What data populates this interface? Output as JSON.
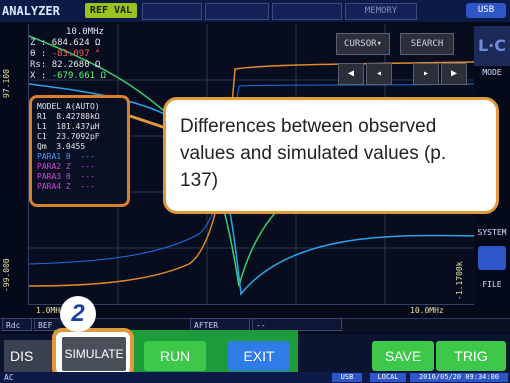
{
  "header": {
    "analyzer_label": "ANALYZER",
    "ref_val_label": "REF VAL",
    "memory_label": "MEMORY",
    "usb_label": "USB"
  },
  "readout": {
    "frequency": "10.0MHz",
    "lines": [
      {
        "label": "Z :",
        "value": "684.624 Ω"
      },
      {
        "label": "θ :",
        "value": "-83.097 °"
      },
      {
        "label": "Rs:",
        "value": "82.2680 Ω"
      },
      {
        "label": "X :",
        "value": "-679.661 Ω"
      }
    ]
  },
  "graph": {
    "cursor_label": "CURSOR▾",
    "search_label": "SEARCH",
    "y_top_left": "97.100",
    "y_bottom_left": "-99.000",
    "y_bottom_right": "-1.1700k",
    "x_start": "1.0MHz",
    "x_end": "10.0MHz"
  },
  "side_menu": {
    "mode_label": "MODE",
    "system_label": "SYSTEM",
    "file_label": "FILE"
  },
  "model": {
    "title": "MODEL A(AUTO)",
    "params": [
      {
        "text": "R1  8.42788kΩ",
        "color": "#e8e8e8"
      },
      {
        "text": "L1  181.437μH",
        "color": "#e8e8e8"
      },
      {
        "text": "C1  23.7092pF",
        "color": "#e8e8e8"
      },
      {
        "text": "Qm  3.0455",
        "color": "#e8e8e8"
      },
      {
        "text": "PARA1 θ  ---",
        "color": "#3d9bff"
      },
      {
        "text": "PARA2 Z  ---",
        "color": "#d243d6"
      },
      {
        "text": "PARA3 θ  ---",
        "color": "#d243d6"
      },
      {
        "text": "PARA4 Z  ---",
        "color": "#d243d6"
      }
    ]
  },
  "callout": {
    "text": "Differences between observed values and simulated values (p. 137)"
  },
  "bottom": {
    "rdc_label": "Rdc",
    "before_label": "BEF",
    "after_label": "AFTER",
    "disp_label": "DIS",
    "simulate_label": "SIMULATE",
    "run_label": "RUN",
    "exit_label": "EXIT",
    "save_label": "SAVE",
    "trig_label": "TRIG",
    "step_number": "2"
  },
  "status": {
    "ac_label": "AC",
    "usb_label": "USB",
    "local_label": "LOCAL",
    "datetime": "2016/05/20 09:34:00"
  }
}
